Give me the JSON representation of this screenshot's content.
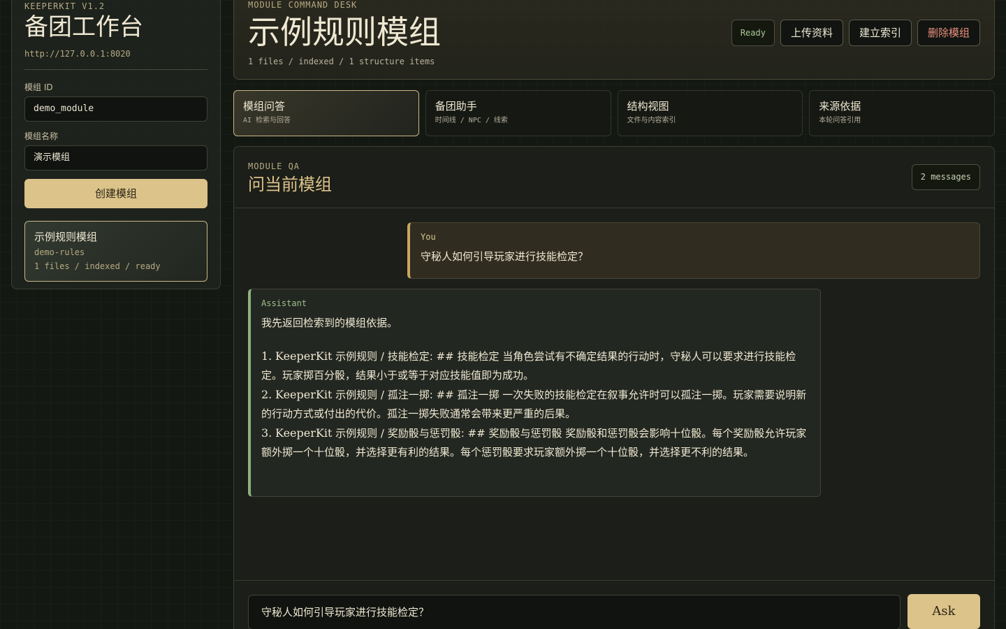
{
  "sidebar": {
    "version": "KEEPERKIT V1.2",
    "title": "备团工作台",
    "url": "http://127.0.0.1:8020",
    "module_id_label": "模组 ID",
    "module_id_value": "demo_module",
    "module_name_label": "模组名称",
    "module_name_value": "演示模组",
    "create_button": "创建模组",
    "modules": [
      {
        "title": "示例规则模组",
        "slug": "demo-rules",
        "meta": "1 files / indexed / ready"
      }
    ]
  },
  "header": {
    "eyebrow": "MODULE COMMAND DESK",
    "title": "示例规则模组",
    "meta": "1 files / indexed / 1 structure items",
    "status": "Ready",
    "upload_button": "上传资料",
    "index_button": "建立索引",
    "delete_button": "删除模组"
  },
  "tabs": [
    {
      "title": "模组问答",
      "sub": "AI 检索与回答",
      "active": true
    },
    {
      "title": "备团助手",
      "sub": "时间线 / NPC / 线索"
    },
    {
      "title": "结构视图",
      "sub": "文件与内容索引"
    },
    {
      "title": "来源依据",
      "sub": "本轮问答引用"
    }
  ],
  "qa": {
    "eyebrow": "MODULE QA",
    "title": "问当前模组",
    "count": "2 messages",
    "user": {
      "role": "You",
      "text": "守秘人如何引导玩家进行技能检定？"
    },
    "assistant": {
      "role": "Assistant",
      "intro": "我先返回检索到的模组依据。",
      "items": [
        {
          "num": "1.",
          "src": "KeeperKit",
          "text": " 示例规则 / 技能检定: ## 技能检定  当角色尝试有不确定结果的行动时，守秘人可以要求进行技能检定。玩家掷百分骰，结果小于或等于对应技能值即为成功。"
        },
        {
          "num": "2.",
          "src": "KeeperKit",
          "text": " 示例规则 / 孤注一掷: ## 孤注一掷  一次失败的技能检定在叙事允许时可以孤注一掷。玩家需要说明新的行动方式或付出的代价。孤注一掷失败通常会带来更严重的后果。"
        },
        {
          "num": "3.",
          "src": "KeeperKit",
          "text": " 示例规则 / 奖励骰与惩罚骰: ## 奖励骰与惩罚骰  奖励骰和惩罚骰会影响十位骰。每个奖励骰允许玩家额外掷一个十位骰，并选择更有利的结果。每个惩罚骰要求玩家额外掷一个十位骰，并选择更不利的结果。"
        }
      ]
    },
    "input_value": "守秘人如何引导玩家进行技能检定？",
    "ask_button": "Ask"
  },
  "colors": {
    "accent_gold": "#dcc389",
    "assistant_green": "#8fb07c",
    "user_gold": "#c9a65e",
    "danger": "#e98f7e"
  }
}
